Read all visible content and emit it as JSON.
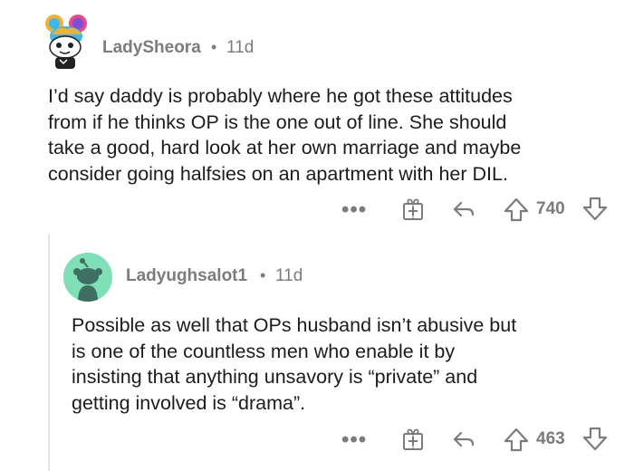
{
  "comments": [
    {
      "username": "LadySheora",
      "separator": "•",
      "time": "11d",
      "body_lines": [
        "I’d say daddy is probably where he got these attitudes",
        "from if he thinks OP is the one out of line. She should",
        "take a good, hard look at her own marriage and maybe",
        "consider going halfsies on an apartment with her DIL."
      ],
      "more_label": "•••",
      "score": "740",
      "avatar_icon": "snoo-avatar-icon"
    },
    {
      "username": "Ladyughsalot1",
      "separator": "•",
      "time": "11d",
      "body_lines": [
        "Possible as well that OPs husband isn’t abusive but",
        "is one of the countless men who enable it by",
        "insisting that anything unsavory is “private” and",
        "getting involved is “drama”."
      ],
      "more_label": "•••",
      "score": "463",
      "avatar_icon": "default-snoo-avatar-icon"
    }
  ],
  "colors": {
    "meta_gray": "#7c7c7c",
    "text": "#1c1c1c",
    "thread_line": "#e6e6e6",
    "default_avatar_bg": "#7fe0b7"
  }
}
